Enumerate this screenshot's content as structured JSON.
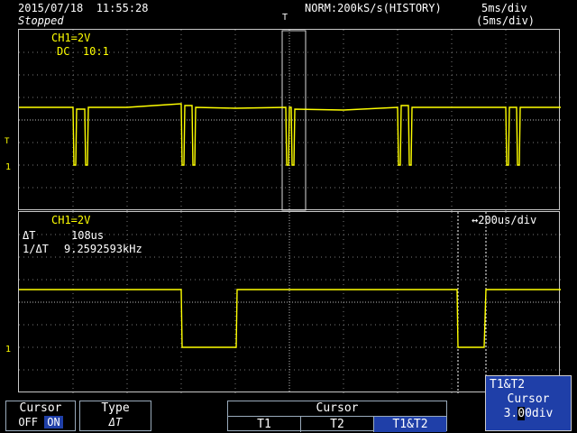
{
  "header": {
    "datetime": "2015/07/18  11:55:28",
    "status": "Stopped",
    "trigger_mode": "NORM:200kS/s(HISTORY)",
    "timebase_main": "5ms/div",
    "timebase_zoom": "(5ms/div)"
  },
  "upper_panel": {
    "channel": "CH1=2V",
    "coupling": "DC  10:1"
  },
  "lower_panel": {
    "channel": "CH1=2V",
    "delta_t_label": "ΔT",
    "delta_t_value": "108us",
    "inv_delta_t_label": "1/ΔT",
    "inv_delta_t_value": "9.2592593kHz",
    "zoom_timebase": "↔200us/div"
  },
  "markers": {
    "trigger_t": "T",
    "level_arrow": "T",
    "ground_one": "1"
  },
  "cursor_readout": {
    "title": "T1&T2",
    "label": "Cursor",
    "value_prefix": "3.",
    "value_caret": "0",
    "value_suffix": "0div"
  },
  "softkeys": {
    "cursor": {
      "title": "Cursor",
      "off": "OFF",
      "on": "ON"
    },
    "type": {
      "title": "Type",
      "value": "ΔT"
    },
    "cursor_select": {
      "title": "Cursor",
      "t1": "T1",
      "t2": "T2",
      "t1t2": "T1&T2"
    }
  },
  "colors": {
    "trace": "#ffff00",
    "softkey_blue": "#1f3fa8",
    "grid": "#8a8a8a"
  }
}
